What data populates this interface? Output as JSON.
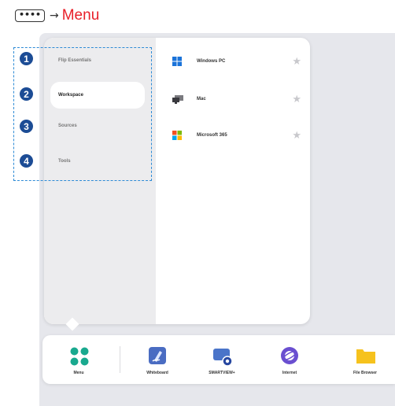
{
  "header": {
    "dots_glyph": "••••",
    "arrow": "→",
    "menu_word": "Menu"
  },
  "menu": {
    "nav_items": [
      {
        "label": "Flip Essentials",
        "active": false
      },
      {
        "label": "Workspace",
        "active": true
      },
      {
        "label": "Sources",
        "active": false
      },
      {
        "label": "Tools",
        "active": false
      }
    ],
    "apps": [
      {
        "label": "Windows PC",
        "icon": "windows-icon",
        "favorite": false
      },
      {
        "label": "Mac",
        "icon": "mac-monitor-icon",
        "favorite": false
      },
      {
        "label": "Microsoft 365",
        "icon": "microsoft-365-icon",
        "favorite": false
      }
    ],
    "star_glyph": "★"
  },
  "callout_numbers": [
    "1",
    "2",
    "3",
    "4"
  ],
  "taskbar": {
    "items": [
      {
        "label": "Menu",
        "icon": "menu-grid-icon"
      },
      {
        "label": "Whiteboard",
        "icon": "whiteboard-icon"
      },
      {
        "label": "SMARTVIEW+",
        "icon": "smartview-icon"
      },
      {
        "label": "Internet",
        "icon": "internet-icon"
      },
      {
        "label": "File Browser",
        "icon": "folder-icon"
      }
    ]
  },
  "colors": {
    "accent_red": "#e8202a",
    "callout_blue": "#1c4c95",
    "dash_blue": "#2e8bd6",
    "menu_teal": "#19a98f",
    "folder_yellow": "#f6c21d"
  }
}
